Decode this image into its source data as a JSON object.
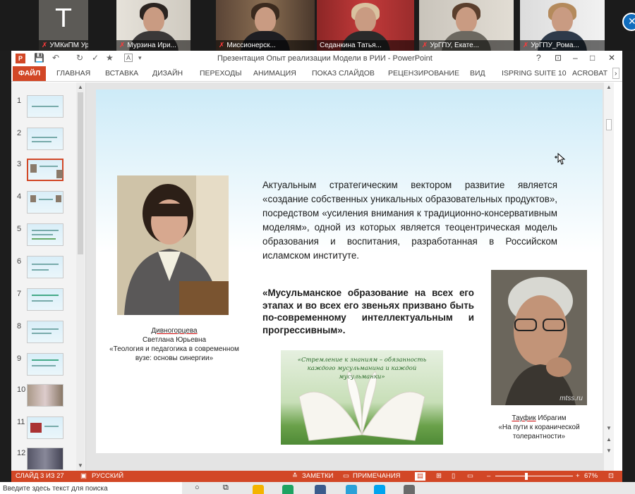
{
  "meeting": {
    "participants": [
      {
        "name": "УМКиПМ УрГ...",
        "avatar_letter": "T",
        "muted": true
      },
      {
        "name": "Мурзина Ири...",
        "muted": true
      },
      {
        "name": "Миссионерск...",
        "muted": true
      },
      {
        "name": "Седанкина Татья...",
        "muted": false
      },
      {
        "name": "УрГПУ, Екате...",
        "muted": true
      },
      {
        "name": "УрГПУ_Рома...",
        "muted": true
      }
    ],
    "close_glyph": "✕"
  },
  "window": {
    "title": "Презентация Опыт реализации Модели в РИИ - PowerPoint",
    "app_icon": "P",
    "quick_access": {
      "save": "💾",
      "undo": "↶",
      "redo": "↻",
      "font_size": "A"
    },
    "controls": {
      "help": "?",
      "ribbon_display": "⊡",
      "minimize": "–",
      "maximize": "□",
      "close": "✕"
    }
  },
  "ribbon": {
    "tabs": [
      "ФАЙЛ",
      "ГЛАВНАЯ",
      "ВСТАВКА",
      "ДИЗАЙН",
      "ПЕРЕХОДЫ",
      "АНИМАЦИЯ",
      "ПОКАЗ СЛАЙДОВ",
      "РЕЦЕНЗИРОВАНИЕ",
      "ВИД",
      "ISPRING SUITE 10",
      "ACROBAT"
    ],
    "active_tab": "ФАЙЛ",
    "more": "›"
  },
  "thumbnails": {
    "numbers": [
      "1",
      "2",
      "3",
      "4",
      "5",
      "6",
      "7",
      "8",
      "9",
      "10",
      "11",
      "12"
    ],
    "selected": "3"
  },
  "slide": {
    "paragraph": "Актуальным стратегическим вектором развитие является «создание собственных уникальных образовательных продуктов», посредством «усиления внимания к традиционно-консервативным моделям», одной из которых является теоцентрическая модель образования и воспитания, разработанная в Российском исламском институте.",
    "quote": "«Мусульманское образование на всех его этапах и во всех его звеньях призвано быть по-современному интеллектуальным и прогрессивным».",
    "left_caption": {
      "surname": "Дивногорцева",
      "name": "Светлана Юрьевна",
      "work": "«Теология и педагогика в современном вузе: основы синергии»"
    },
    "right_caption": {
      "surname": "Тауфик",
      "name": "Ибрагим",
      "work": "«На пути к коранической толерантности»"
    },
    "book_quote": "«Стремление к знаниям – обязанность каждого мусульманина и каждой мусульманки»",
    "watermark": "mtss.ru"
  },
  "status_bar": {
    "slide_counter": "СЛАЙД 3 ИЗ 27",
    "language": "РУССКИЙ",
    "notes": "ЗАМЕТКИ",
    "comments": "ПРИМЕЧАНИЯ",
    "zoom": "67%",
    "zoom_minus": "–",
    "zoom_plus": "+"
  },
  "taskbar": {
    "search_placeholder": "Введите здесь текст для поиска"
  },
  "colors": {
    "accent": "#d24726",
    "slide_top": "#cdebf8"
  }
}
